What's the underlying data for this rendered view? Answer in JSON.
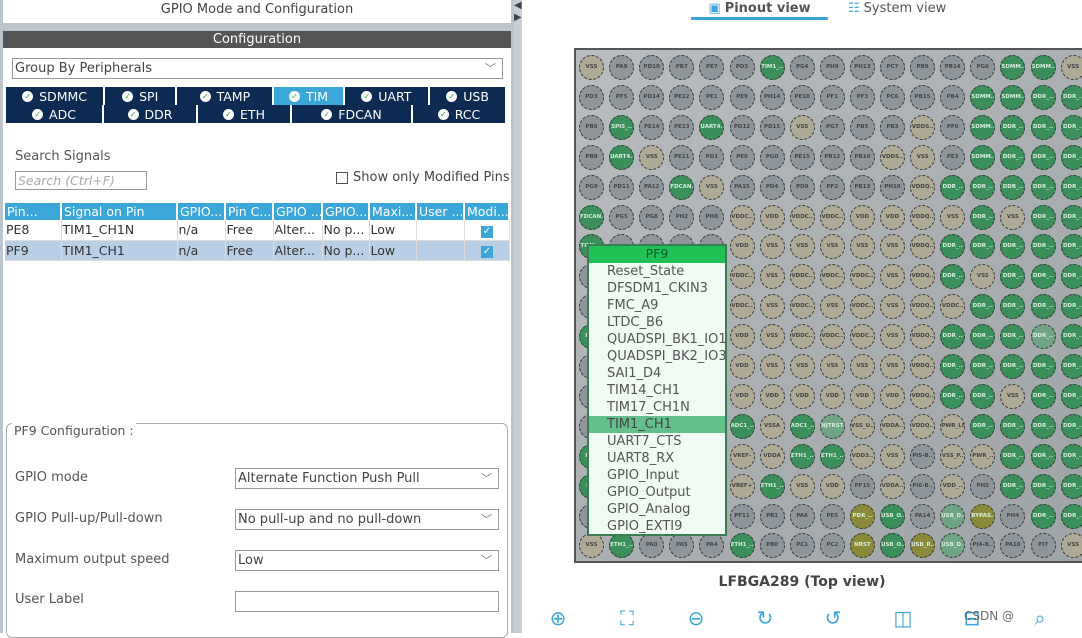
{
  "left": {
    "title": "GPIO Mode and Configuration",
    "config_header": "Configuration",
    "group_by": "Group By Peripherals",
    "tabs_row1": [
      {
        "label": "SDMMC"
      },
      {
        "label": "SPI"
      },
      {
        "label": "TAMP"
      },
      {
        "label": "TIM",
        "active": true
      },
      {
        "label": "UART"
      },
      {
        "label": "USB"
      }
    ],
    "tabs_row2": [
      {
        "label": "ADC"
      },
      {
        "label": "DDR"
      },
      {
        "label": "ETH"
      },
      {
        "label": "FDCAN"
      },
      {
        "label": "RCC"
      }
    ],
    "search_label": "Search Signals",
    "search_placeholder": "Search (Ctrl+F)",
    "show_modified": "Show only Modified Pins",
    "table": {
      "headers": [
        "Pin...",
        "Signal on Pin",
        "GPIO...",
        "Pin C...",
        "GPIO ...",
        "GPIO...",
        "Maxi...",
        "User ...",
        "Modi..."
      ],
      "rows": [
        [
          "PE8",
          "TIM1_CH1N",
          "n/a",
          "Free",
          "Alter...",
          "No p...",
          "Low",
          "",
          true
        ],
        [
          "PF9",
          "TIM1_CH1",
          "n/a",
          "Free",
          "Alter...",
          "No p...",
          "Low",
          "",
          true
        ]
      ]
    },
    "config": {
      "legend": "PF9 Configuration :",
      "gpio_mode_label": "GPIO mode",
      "gpio_mode": "Alternate Function Push Pull",
      "pull_label": "GPIO Pull-up/Pull-down",
      "pull": "No pull-up and no pull-down",
      "speed_label": "Maximum output speed",
      "speed": "Low",
      "user_label": "User Label",
      "user_value": ""
    }
  },
  "right": {
    "tabs": [
      {
        "label": "Pinout view",
        "icon": "chip-icon",
        "active": true
      },
      {
        "label": "System view",
        "icon": "list-icon"
      }
    ],
    "package": "LFBGA289 (Top view)",
    "pin_colors": {
      "g": "#8f969b",
      "v": "#aeaa96",
      "G": "#3a8f5a",
      "L": "#6fa585",
      "Y": "#8a8a3a"
    },
    "pins": [
      [
        "v:VSS",
        "g:PA9",
        "g:PD10",
        "g:PB7",
        "g:PE7",
        "g:PD5",
        "G:TIM1_..",
        "g:PG4",
        "g:PH9",
        "g:PH13",
        "g:PC7",
        "g:PB9",
        "g:PB14",
        "g:PG6",
        "G:SDMM..",
        "G:SDMM..",
        "v:VSS"
      ],
      [
        "g:PD3",
        "g:PF5",
        "g:PD14",
        "g:PE12",
        "g:PE1",
        "g:PE9",
        "g:PH14",
        "g:PE10",
        "g:PF1",
        "g:PF3",
        "g:PC6",
        "g:PB15",
        "g:PB4",
        "G:SDMM..",
        "G:SDMM..",
        "G:DDR_..",
        "G:DDR_.."
      ],
      [
        "g:PB6",
        "G:SPI5_..",
        "g:PE14",
        "g:PE13",
        "G:UART4..",
        "g:PD12",
        "g:PD15",
        "v:VSS",
        "g:PG7",
        "g:PB5",
        "g:PB3",
        "v:VDDS..",
        "g:PF0",
        "G:SDMM..",
        "G:DDR_..",
        "G:DDR_..",
        "G:DDR_.."
      ],
      [
        "g:PB8",
        "G:UART4..",
        "v:VSS",
        "g:PE11",
        "g:PD1",
        "g:PE0",
        "g:PG0",
        "g:PE15",
        "g:PB12",
        "g:PB10",
        "v:VDDS..",
        "v:VSS",
        "g:PE3",
        "G:SDMM..",
        "G:DDR_..",
        "G:DDR_..",
        "G:DDR_.."
      ],
      [
        "g:PG9",
        "g:PD11",
        "g:PA12",
        "G:FDCAN..",
        "v:VSS",
        "g:PA15",
        "g:PD4",
        "g:PD9",
        "g:PF2",
        "g:PB13",
        "g:PH10",
        "v:VDDQ..",
        "G:DDR_..",
        "G:DDR_..",
        "G:DDR_..",
        "G:DDR_..",
        "G:DDR_.."
      ],
      [
        "G:FDCAN..",
        "g:PG5",
        "g:PG8",
        "g:PH2",
        "g:PH8",
        "v:VDDC..",
        "v:VDD",
        "v:VDDC..",
        "v:VDDC..",
        "v:VDD",
        "v:VDD",
        "v:VDDQ..",
        "v:VSS",
        "G:DDR_..",
        "v:VSS",
        "G:DDR_..",
        "G:DDR_.."
      ],
      [
        "G:TIM1_..",
        "g:",
        "g:",
        "g:",
        "g:",
        "v:VDD",
        "v:VSS",
        "v:VSS",
        "v:VSS",
        "v:VSS",
        "v:VSS",
        "v:VDDQ..",
        "G:DDR_..",
        "G:DDR_..",
        "G:DDR_..",
        "G:DDR_..",
        "G:DDR_.."
      ],
      [
        "g:",
        "g:",
        "g:",
        "g:",
        "g:",
        "v:VDDC..",
        "v:VSS",
        "v:VDDC..",
        "v:VDDC..",
        "v:VDDC..",
        "v:VSS",
        "v:VDDQ..",
        "G:DDR_..",
        "v:VSS",
        "G:DDR_..",
        "G:DDR_..",
        "G:DDR_.."
      ],
      [
        "g:",
        "g:",
        "g:",
        "g:",
        "g:",
        "v:VDDC..",
        "v:VSS",
        "v:VDDC..",
        "v:VSS",
        "v:VDDC..",
        "v:VSS",
        "v:VDDQ..",
        "v:VDDC..",
        "G:DDR_..",
        "G:DDR_..",
        "G:DDR_..",
        "G:DDR_.."
      ],
      [
        "G:RC..",
        "g:",
        "g:",
        "g:",
        "g:",
        "v:VDD",
        "v:VSS",
        "v:VDDC..",
        "v:VDDC..",
        "v:VDDC..",
        "v:VSS",
        "v:VDDQ..",
        "G:DDR_..",
        "G:DDR_..",
        "G:DDR_..",
        "L:DDR_..",
        "G:DDR_.."
      ],
      [
        "g:",
        "g:",
        "g:",
        "g:",
        "g:",
        "v:VDD",
        "v:VSS",
        "v:VSS",
        "v:VSS",
        "v:VSS",
        "v:VSS",
        "v:VDDQ..",
        "G:DDR_..",
        "G:DDR_..",
        "G:DDR_..",
        "G:DDR_..",
        "G:DDR_.."
      ],
      [
        "g:",
        "g:",
        "g:",
        "g:",
        "g:",
        "v:VDD",
        "v:VDD",
        "v:VDD",
        "v:VDD",
        "v:VDD",
        "v:VDD",
        "v:VDDQ..",
        "G:DDR_..",
        "G:DDR_..",
        "v:VSS",
        "G:DDR_..",
        "G:DDR_.."
      ],
      [
        "g:",
        "g:",
        "g:",
        "g:",
        "g:",
        "G:ADC1_..",
        "v:VSSA",
        "G:ADC1_..",
        "L:NJTRST",
        "v:VSS_U..",
        "v:VDDA..",
        "v:VDDQ..",
        "v:PWR_LP",
        "G:DDR_..",
        "G:DDR_..",
        "G:DDR_..",
        "G:DDR_.."
      ],
      [
        "G:RC..",
        "g:",
        "g:",
        "g:",
        "g:",
        "v:VREF-",
        "v:VDDA",
        "G:ETH1_..",
        "G:ETH1_..",
        "v:VDD3..",
        "v:VSS",
        "g:PI5-B..",
        "v:VSS_P..",
        "v:PWR_..",
        "G:DDR_..",
        "G:DDR_..",
        "G:DDR_.."
      ],
      [
        "G:ET..",
        "g:",
        "g:",
        "g:",
        "g:",
        "v:VREF+",
        "G:ETH1_..",
        "v:VSS",
        "v:VDD",
        "g:PF15",
        "v:VDDA..",
        "g:PI6-B..",
        "v:VDD_..",
        "g:PH5",
        "G:DDR_..",
        "G:DDR_..",
        "G:DDR_.."
      ],
      [
        "g:P..",
        "g:",
        "g:",
        "g:",
        "g:",
        "g:PF11",
        "g:PB1",
        "g:PA6",
        "g:PE5",
        "Y:PDR_..",
        "G:USB_O..",
        "g:PA14",
        "L:USB_D..",
        "Y:BYPAS..",
        "g:PH4",
        "G:DDR_..",
        "G:DDR_.."
      ],
      [
        "v:VSS",
        "G:ETH1_..",
        "g:PA0",
        "g:PA5",
        "g:PA4",
        "G:ETH1_..",
        "g:PB0",
        "g:PC1",
        "g:PC2",
        "Y:NRST",
        "G:USB_O..",
        "Y:USB_R..",
        "L:USB_D..",
        "g:PI4-B..",
        "g:PA10",
        "g:PI7",
        "v:VSS"
      ]
    ],
    "popup": {
      "pin": "PF9",
      "items": [
        "Reset_State",
        "DFSDM1_CKIN3",
        "FMC_A9",
        "LTDC_B6",
        "QUADSPI_BK1_IO1",
        "QUADSPI_BK2_IO3",
        "SAI1_D4",
        "TIM14_CH1",
        "TIM17_CH1N",
        "TIM1_CH1",
        "UART7_CTS",
        "UART8_RX",
        "GPIO_Input",
        "GPIO_Output",
        "GPIO_Analog",
        "GPIO_EXTI9"
      ],
      "selected": "TIM1_CH1"
    },
    "toolbar": [
      {
        "icon": "zoom-in-icon",
        "glyph": "⊕"
      },
      {
        "icon": "fit-screen-icon",
        "glyph": "⛶"
      },
      {
        "icon": "zoom-out-icon",
        "glyph": "⊖"
      },
      {
        "icon": "rotate-right-icon",
        "glyph": "↻"
      },
      {
        "icon": "rotate-left-icon",
        "glyph": "↺"
      },
      {
        "icon": "flip-vertical-icon",
        "glyph": "◫"
      },
      {
        "icon": "flip-horizontal-icon",
        "glyph": "⊟"
      },
      {
        "icon": "search-icon",
        "glyph": "⌕"
      }
    ],
    "watermark": "CSDN @"
  }
}
